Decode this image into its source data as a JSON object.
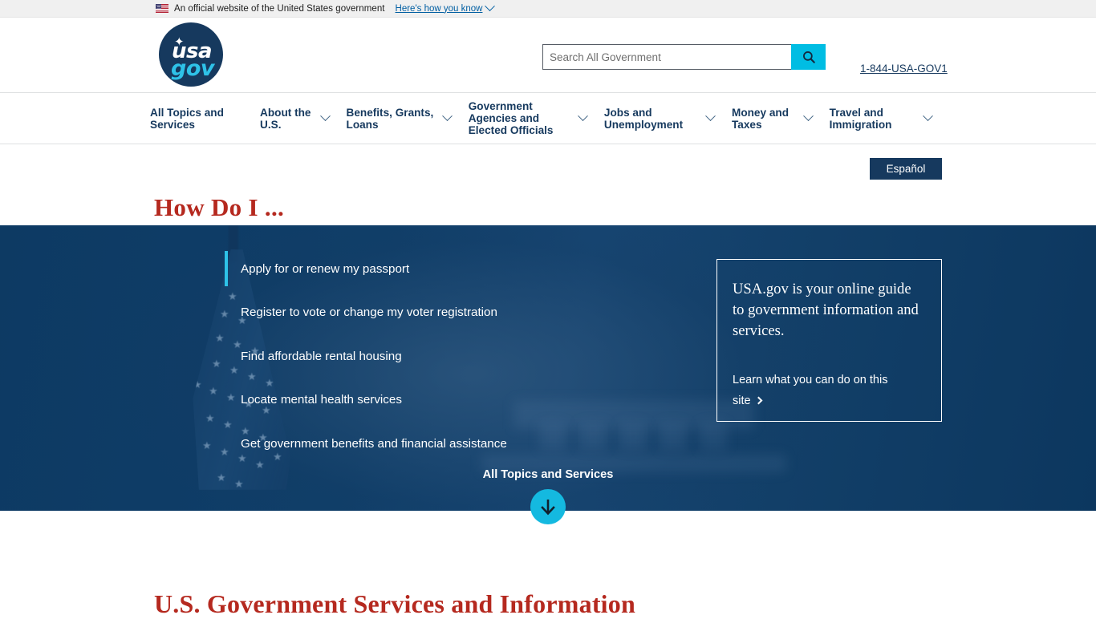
{
  "banner": {
    "flag_icon": "us-flag-icon",
    "text": "An official website of the United States government",
    "toggle_label": "Here's how you know",
    "chevron_icon": "chevron-down-icon"
  },
  "header": {
    "logo": {
      "name": "usagov-logo",
      "primary": "usa",
      "secondary": "gov",
      "star_icon": "star-icon"
    },
    "search": {
      "placeholder": "Search All Government",
      "value": "",
      "button_icon": "search-icon"
    },
    "phone": "1-844-USA-GOV1"
  },
  "nav": {
    "items": [
      {
        "label": "All Topics and Services",
        "has_chevron": false
      },
      {
        "label": "About the U.S.",
        "has_chevron": true
      },
      {
        "label": "Benefits, Grants, Loans",
        "has_chevron": true
      },
      {
        "label": "Government Agencies and Elected Officials",
        "has_chevron": true
      },
      {
        "label": "Jobs and Unemployment",
        "has_chevron": true
      },
      {
        "label": "Money and Taxes",
        "has_chevron": true
      },
      {
        "label": "Travel and Immigration",
        "has_chevron": true
      }
    ]
  },
  "howdoi": {
    "title": "How Do I ...",
    "espanol_label": "Español",
    "items": [
      {
        "label": "Apply for or renew my passport",
        "active": true
      },
      {
        "label": "Register to vote or change my voter registration",
        "active": false
      },
      {
        "label": "Find affordable rental housing",
        "active": false
      },
      {
        "label": "Locate mental health services",
        "active": false
      },
      {
        "label": "Get government benefits and financial assistance",
        "active": false
      }
    ],
    "all_topics_link": "All Topics and Services",
    "scroll_icon": "arrow-down-icon"
  },
  "info_card": {
    "text": "USA.gov is your online guide to government information and services.",
    "link_label": "Learn what you can do on this site",
    "link_icon": "chevron-right-icon"
  },
  "services": {
    "title": "U.S. Government Services and Information"
  },
  "colors": {
    "accent_cyan": "#00bde3",
    "navy": "#16395e",
    "hero_navy": "#0d3a63",
    "heading_red": "#b5291f",
    "link_blue": "#005ea2"
  }
}
